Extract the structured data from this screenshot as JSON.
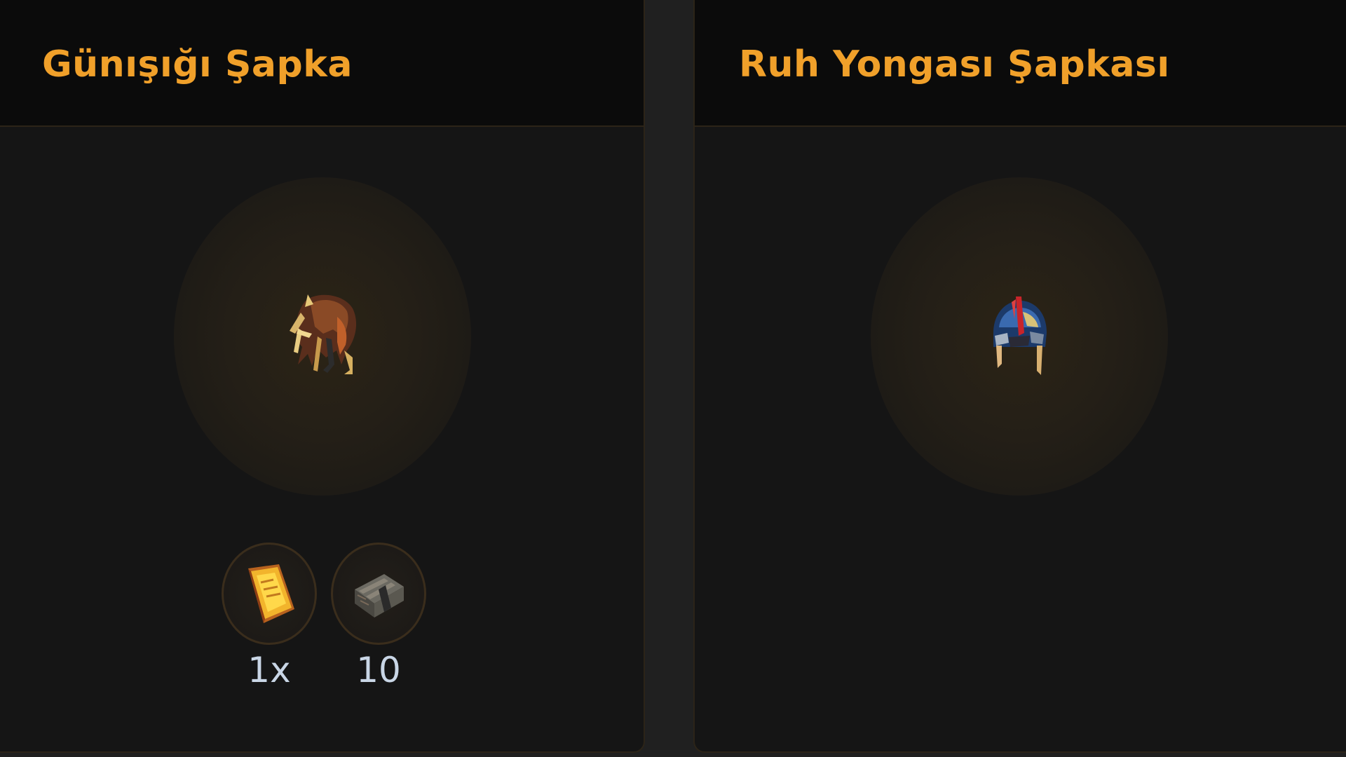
{
  "cards": [
    {
      "title": "Günışığı Şapka",
      "item_icon": "sunlight-hat-icon",
      "requirements": [
        {
          "icon": "golden-scroll-icon",
          "label": "1x"
        },
        {
          "icon": "stone-bundle-icon",
          "label": "10"
        }
      ]
    },
    {
      "title": "Ruh Yongası Şapkası",
      "item_icon": "soul-shard-hat-icon",
      "requirements": []
    }
  ],
  "colors": {
    "background": "#202020",
    "card": "#151515",
    "header": "#0b0b0b",
    "title": "#f0a02a",
    "label": "#c9d6e6",
    "border": "#2c2418"
  }
}
